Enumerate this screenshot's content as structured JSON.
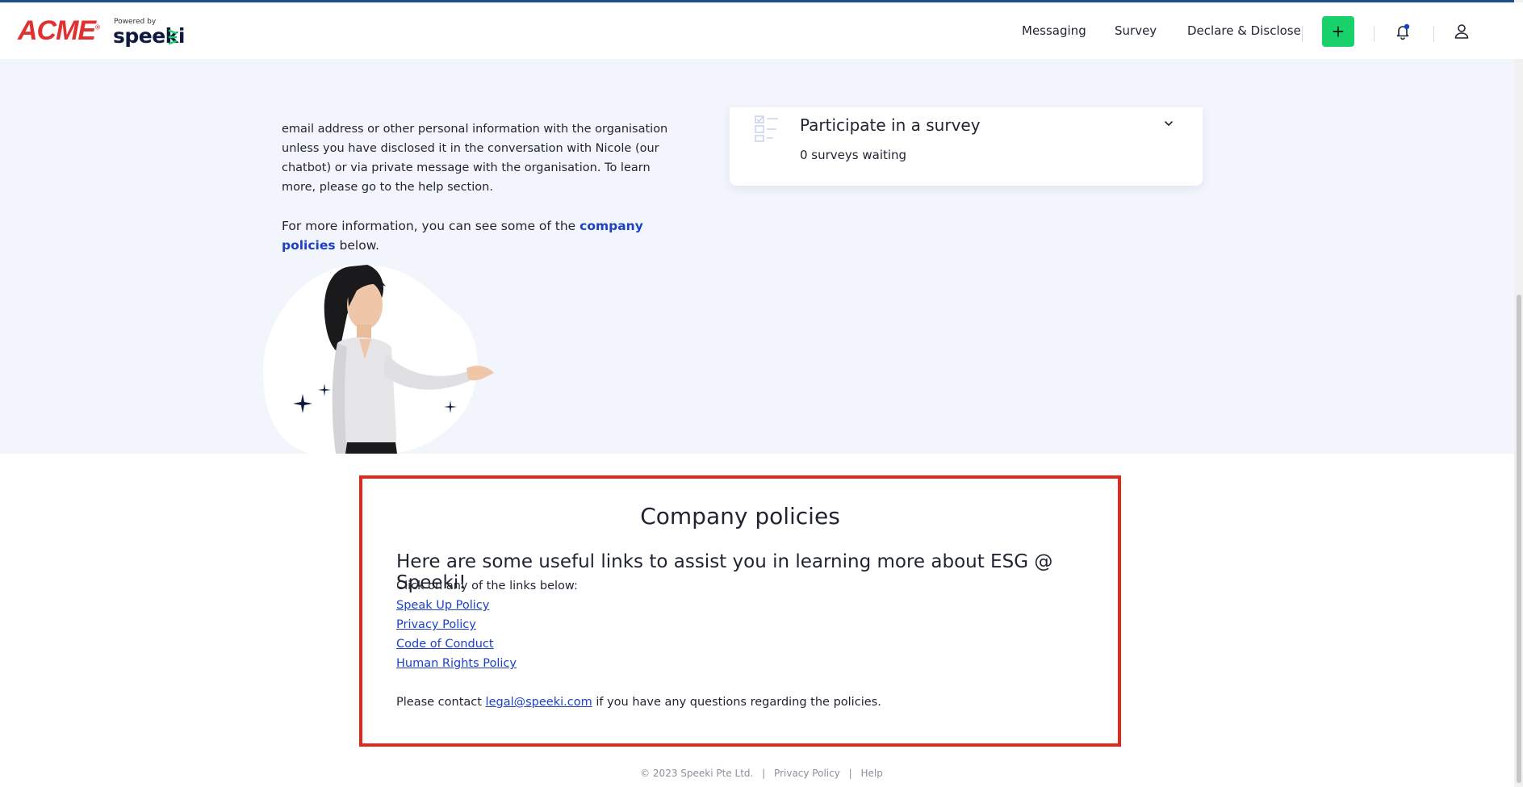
{
  "brand": {
    "client_logo": "ACME",
    "powered_by": "Powered by",
    "product": "speeki"
  },
  "nav": {
    "items": [
      {
        "label": "Messaging"
      },
      {
        "label": "Survey"
      },
      {
        "label": "Declare & Disclose"
      }
    ],
    "add_icon": "plus-icon",
    "notification_icon": "bell-icon",
    "notification_dot_color": "#1d41c5",
    "profile_icon": "user-icon",
    "add_button_color": "#18d16a"
  },
  "intro": {
    "privacy_text": "email address or other personal information with the organisation unless you have disclosed it in the conversation with Nicole (our chatbot) or via private message with the organisation. To learn more, please go to the help section.",
    "more_info_prefix": "For more information, you can see some of the ",
    "more_info_link": "company policies",
    "more_info_suffix": " below."
  },
  "survey_card": {
    "title": "Participate in a survey",
    "count_text": "0 surveys waiting",
    "icon": "survey-checklist-icon",
    "toggle_icon": "chevron-down-icon"
  },
  "policies": {
    "title": "Company policies",
    "subtitle": "Here are some useful links to assist you in learning more about ESG @ Speeki!",
    "instruction": "Click on any of the links below:",
    "links": [
      {
        "label": "Speak Up Policy"
      },
      {
        "label": "Privacy Policy"
      },
      {
        "label": "Code of Conduct"
      },
      {
        "label": "Human Rights Policy"
      }
    ],
    "contact_prefix": "Please contact ",
    "contact_email": "legal@speeki.com",
    "contact_suffix": " if you have any questions regarding the policies.",
    "highlight_color": "#e0281e"
  },
  "footer": {
    "copyright": "© 2023 Speeki Pte Ltd.",
    "privacy": "Privacy Policy",
    "help": "Help",
    "separator": "|"
  },
  "colors": {
    "hero_background": "#f3f5fd",
    "link": "#1d41c5",
    "acme_red": "#e03030"
  }
}
